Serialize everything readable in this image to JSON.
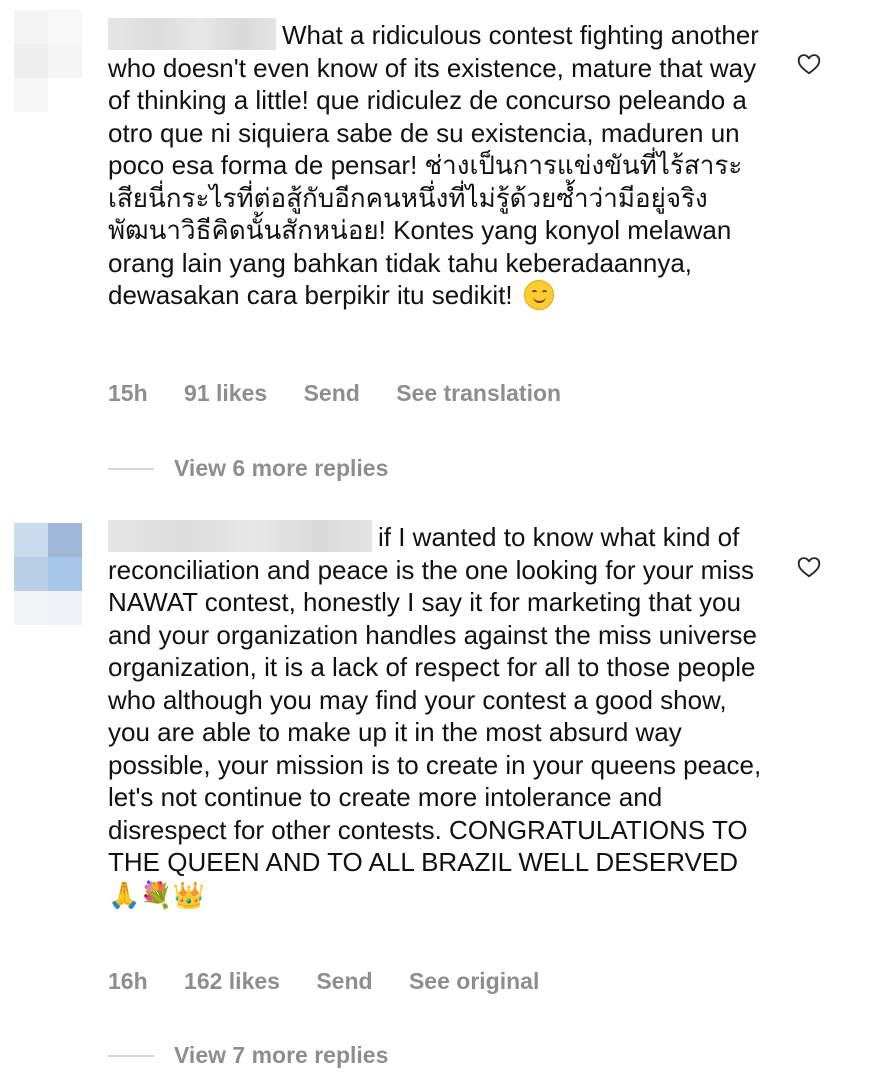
{
  "comments": [
    {
      "text": "What a ridiculous contest fighting another who doesn't even know of its existence, mature that way of thinking a little! que ridiculez de concurso peleando a otro que ni siquiera sabe de su existencia, maduren un poco esa forma de pensar! ช่างเป็นการแข่งขันที่ไร้สาระเสียนี่กระไรที่ต่อสู้กับอีกคนหนึ่งที่ไม่รู้ด้วยซ้ำว่ามีอยู่จริง พัฒนาวิธีคิดนั้นสักหน่อย! Kontes yang konyol melawan orang lain yang bahkan tidak tahu keberadaannya, dewasakan cara berpikir itu sedikit!",
      "emoji": "smiling-face-icon",
      "time": "15h",
      "likes": "91 likes",
      "reply_label": "Send",
      "translate_label": "See translation",
      "view_replies": "View 6 more replies",
      "avatar_colors": [
        "#f3f3f3",
        "#f7f7f7",
        "#eeeeee",
        "#f5f5f5",
        "#f6f6f6",
        "#f1f1f1"
      ]
    },
    {
      "text": "if I wanted to know what kind of reconciliation and peace is the one looking for your miss NAWAT contest, honestly I say it for marketing that you and your organization handles against the miss universe organization, it is a lack of respect for all to those people who although you may find your contest a good show, you are able to make up it in the most absurd way possible, your mission is to create in your queens peace, let's not continue to create more intolerance and disrespect for other contests. CONGRATULATIONS TO THE QUEEN AND TO ALL BRAZIL WELL DESERVED",
      "emoji": "🙏💐👑",
      "time": "16h",
      "likes": "162 likes",
      "reply_label": "Send",
      "translate_label": "See original",
      "view_replies": "View 7 more replies",
      "avatar_colors": [
        "#c9dcee",
        "#9fb8d9",
        "#b8cfe6",
        "#a7c6ea",
        "#f2f4f7",
        "#eef1f5"
      ]
    }
  ],
  "colors": {
    "text": "#111111",
    "meta": "#8e8e8e",
    "divider": "#d6d6d6"
  }
}
